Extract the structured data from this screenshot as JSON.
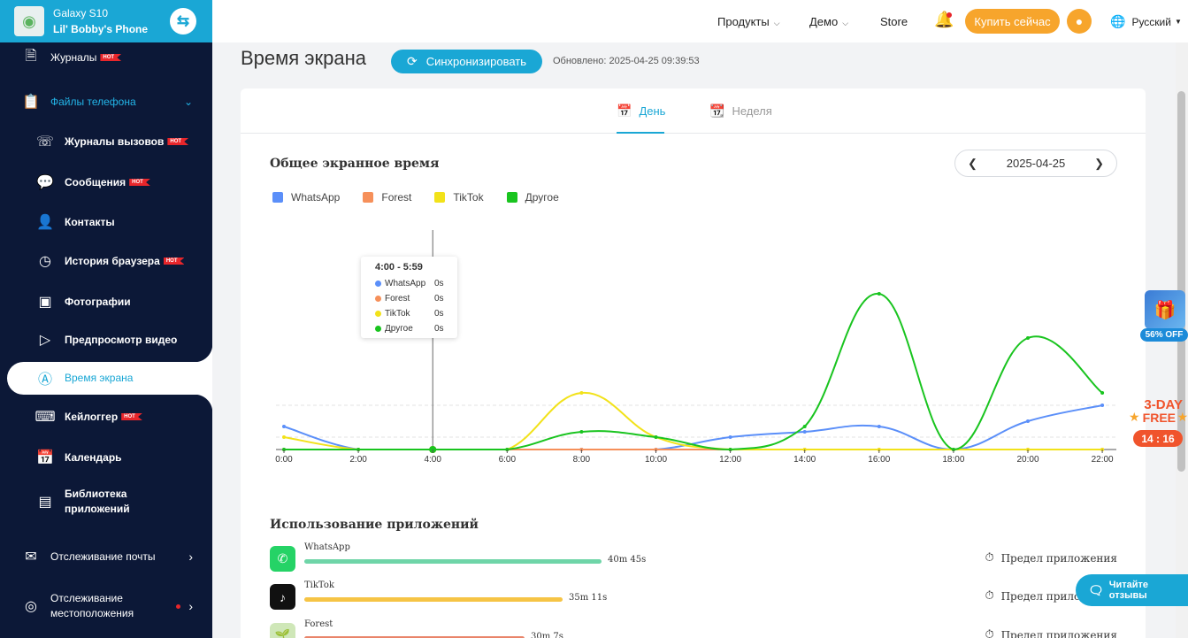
{
  "device": {
    "model": "Galaxy S10",
    "owner": "Lil' Bobby's Phone"
  },
  "sidebar": {
    "hot_label": "HOT",
    "items": [
      {
        "label": "Журналы",
        "hot": true
      },
      {
        "label": "Файлы телефона"
      },
      {
        "label": "Журналы вызовов",
        "hot": true
      },
      {
        "label": "Сообщения",
        "hot": true
      },
      {
        "label": "Контакты"
      },
      {
        "label": "История браузера",
        "hot": true
      },
      {
        "label": "Фотографии"
      },
      {
        "label": "Предпросмотр видео"
      },
      {
        "label": "Время экрана"
      },
      {
        "label": "Кейлоггер",
        "hot": true
      },
      {
        "label": "Календарь"
      },
      {
        "label": "Библиотека приложений"
      },
      {
        "label": "Отслеживание почты"
      },
      {
        "label": "Отслеживание местоположения"
      }
    ]
  },
  "header": {
    "products": "Продукты",
    "demo": "Демо",
    "store": "Store",
    "buy": "Купить сейчас",
    "language": "Русский"
  },
  "main": {
    "title": "Время экрана",
    "sync": "Синхронизировать",
    "updated": "Обновлено: 2025-04-25 09:39:53",
    "tabs": {
      "day": "День",
      "week": "Неделя"
    },
    "total_title": "Общее экранное время",
    "date": "2025-04-25",
    "usage_title": "Использование приложений",
    "limit_label": "Предел приложения"
  },
  "chart_data": {
    "type": "line",
    "smooth": true,
    "x": [
      "0:00",
      "2:00",
      "4:00",
      "6:00",
      "8:00",
      "10:00",
      "12:00",
      "14:00",
      "16:00",
      "18:00",
      "20:00",
      "22:00"
    ],
    "series": [
      {
        "name": "WhatsApp",
        "color": "#5b8ff9",
        "values": [
          26,
          0,
          0,
          0,
          0,
          0,
          14,
          20,
          26,
          0,
          32,
          50
        ]
      },
      {
        "name": "Forest",
        "color": "#f6905a",
        "values": [
          0,
          0,
          0,
          0,
          0,
          0,
          0,
          0,
          0,
          0,
          0,
          0
        ]
      },
      {
        "name": "TikTok",
        "color": "#f2e21a",
        "values": [
          14,
          0,
          0,
          0,
          64,
          14,
          0,
          0,
          0,
          0,
          0,
          0
        ]
      },
      {
        "name": "Другое",
        "color": "#19c41f",
        "values": [
          0,
          0,
          0,
          0,
          20,
          14,
          0,
          26,
          176,
          0,
          126,
          64
        ]
      }
    ],
    "legend_position": "top-left",
    "grid": false,
    "tooltip": {
      "title": "4:00 - 5:59",
      "rows": [
        {
          "name": "WhatsApp",
          "value": "0s"
        },
        {
          "name": "Forest",
          "value": "0s"
        },
        {
          "name": "TikTok",
          "value": "0s"
        },
        {
          "name": "Другое",
          "value": "0s"
        }
      ]
    }
  },
  "apps": [
    {
      "name": "WhatsApp",
      "duration": "40m 45s",
      "bar_fraction": 1.0,
      "color": "#6fd5a8",
      "icon": "whatsapp-icon"
    },
    {
      "name": "TikTok",
      "duration": "35m 11s",
      "bar_fraction": 0.87,
      "color": "#f6c445",
      "icon": "tiktok-icon"
    },
    {
      "name": "Forest",
      "duration": "30m 7s",
      "bar_fraction": 0.74,
      "color": "#e9846a",
      "icon": "forest-icon"
    }
  ],
  "promos": {
    "off": "56% OFF",
    "day1": "3-DAY",
    "day2": "FREE",
    "timer": "14 : 16",
    "reviews": "Читайте отзывы"
  }
}
